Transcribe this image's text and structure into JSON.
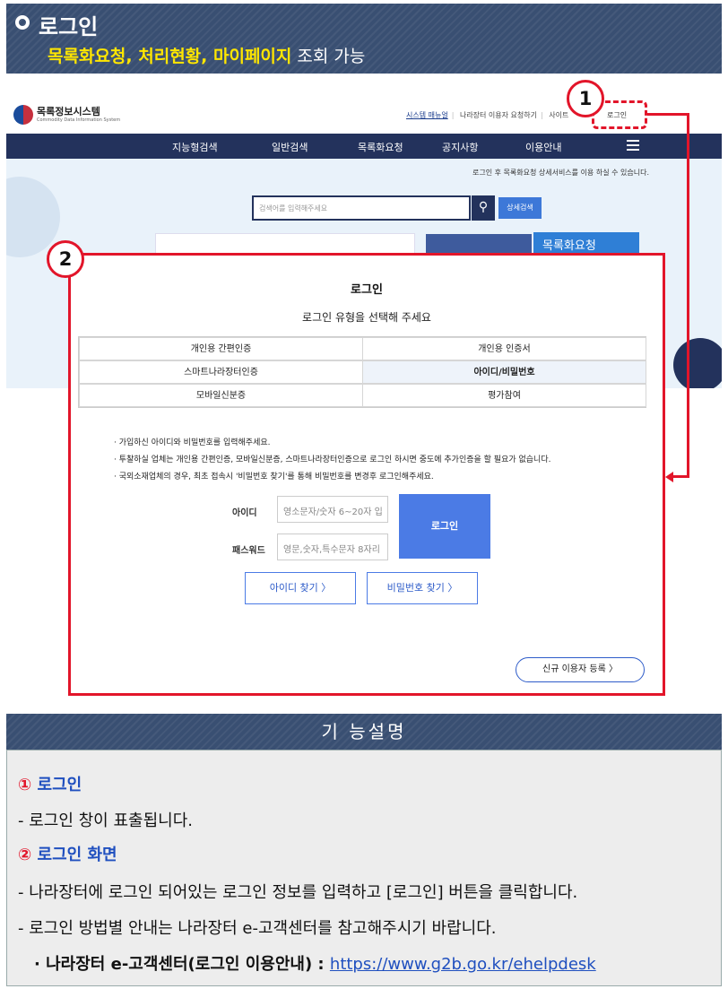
{
  "banner": {
    "title": "로그인",
    "subtitle_highlight": "목록화요청, 처리현황, 마이페이지",
    "subtitle_rest": " 조회 가능"
  },
  "site": {
    "logo_text": "목록정보시스템",
    "logo_sub": "Commodity Data Information System",
    "top_links": [
      "시스템 매뉴얼",
      "나라장터 이용자 요청하기",
      "사이트"
    ],
    "login_link": "로그인",
    "nav": [
      "지능형검색",
      "일반검색",
      "목록화요청",
      "공지사항",
      "이용안내"
    ],
    "hero_note": "로그인 후 목록화요청 상세서비스를 이용 하실 수 있습니다.",
    "search_placeholder": "검색어를 입력해주세요",
    "detail_search": "상세검색",
    "hero_card2": "목록화요청"
  },
  "callouts": {
    "one": "1",
    "two": "2"
  },
  "dialog": {
    "title": "로그인",
    "subtitle": "로그인 유형을 선택해 주세요",
    "auth_options": [
      {
        "label": "개인용 간편인증"
      },
      {
        "label": "개인용 인증서"
      },
      {
        "label": "스마트나라장터인증"
      },
      {
        "label": "아이디/비밀번호"
      },
      {
        "label": "모바일신분증"
      },
      {
        "label": "평가참여"
      }
    ],
    "notes": [
      "· 가입하신 아이디와 비밀번호를 입력해주세요.",
      "· 투찰하실 업체는 개인용 간편인증, 모바일신분증, 스마트나라장터인증으로 로그인 하시면 중도에 추가인증을 할 필요가 없습니다.",
      "· 국외소재업체의 경우, 최초 접속시 '비밀번호 찾기'를 통해 비밀번호를 변경후 로그인해주세요."
    ],
    "id_label": "아이디",
    "id_placeholder": "영소문자/숫자 6~20자 입",
    "pw_label": "패스워드",
    "pw_placeholder": "영문,숫자,특수문자 8자리",
    "login_button": "로그인",
    "find_id": "아이디 찾기 〉",
    "find_pw": "비밀번호 찾기 〉",
    "new_user": "신규 이용자 등록 〉"
  },
  "description": {
    "header": "기 능설명",
    "item1_num": "①",
    "item1_title": " 로그인",
    "item1_text": "- 로그인 창이 표출됩니다.",
    "item2_num": "②",
    "item2_title": " 로그인 화면",
    "item2_text1": "- 나라장터에 로그인 되어있는 로그인 정보를 입력하고 [로그인] 버튼을 클릭합니다.",
    "item2_text2": "- 로그인 방법별 안내는 나라장터  e-고객센터를 참고해주시기 바랍니다.",
    "item2_text3": "· 나라장터 e-고객센터(로그인 이용안내) : ",
    "item2_link": "https://www.g2b.go.kr/ehelpdesk"
  },
  "colors": {
    "accent_red": "#E2152A",
    "navy": "#394F72",
    "blue": "#4B7BE5"
  }
}
